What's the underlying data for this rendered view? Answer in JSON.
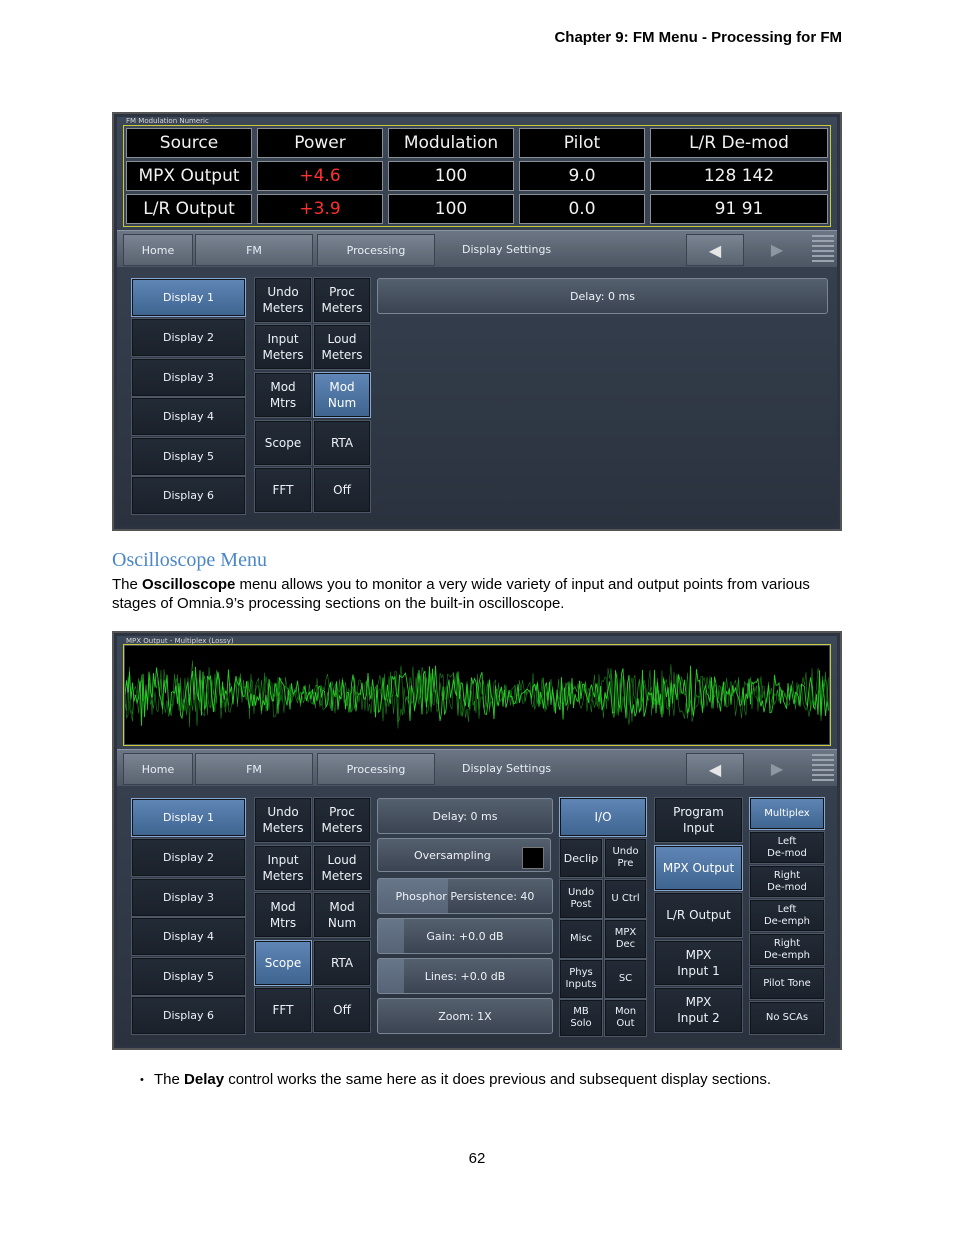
{
  "header": "Chapter 9:  FM Menu - Processing for FM",
  "section_title": "Oscilloscope Menu",
  "intro": {
    "before": "The ",
    "bold": "Oscilloscope",
    "after": " menu allows you to monitor a very wide variety of input and output points from various stages of Omnia.9’s processing sections on the built-in oscilloscope."
  },
  "bullet": {
    "before": "The ",
    "bold": "Delay",
    "after": " control works the same here as it does previous and subsequent display sections."
  },
  "page_number": "62",
  "nav": {
    "home": "Home",
    "fm": "FM",
    "processing": "Processing",
    "display_settings": "Display Settings",
    "prev_icon": "triangle-left-icon",
    "next_icon": "triangle-right-icon",
    "menu_icon": "gripper-lines-icon"
  },
  "displays": [
    "Display 1",
    "Display 2",
    "Display 3",
    "Display 4",
    "Display 5",
    "Display 6"
  ],
  "meter_buttons": {
    "undo_meters": "Undo\nMeters",
    "proc_meters": "Proc\nMeters",
    "input_meters": "Input\nMeters",
    "loud_meters": "Loud\nMeters",
    "mod_mtrs": "Mod\nMtrs",
    "mod_num": "Mod\nNum",
    "scope": "Scope",
    "rta": "RTA",
    "fft": "FFT",
    "off": "Off"
  },
  "shot1": {
    "title": "FM Modulation Numeric",
    "headers": [
      "Source",
      "Power",
      "Modulation",
      "Pilot",
      "L/R De-mod"
    ],
    "rows": [
      [
        "MPX Output",
        "+4.6",
        "100",
        "9.0",
        "128 142"
      ],
      [
        "L/R Output",
        "+3.9",
        "100",
        "0.0",
        "91 91"
      ]
    ],
    "delay": "Delay: 0 ms",
    "active_display": "Display 1",
    "active_mode": "Mod Num",
    "accent_colors": {
      "warning": "#ff3030",
      "active": "#4f78a8"
    }
  },
  "shot2": {
    "title": "MPX Output - Multiplex (Lossy)",
    "trace_color": "#2bd52b",
    "active_display": "Display 1",
    "active_mode": "Scope",
    "controls": {
      "delay": "Delay: 0 ms",
      "oversampling": "Oversampling",
      "phosphor": "Phosphor Persistence: 40",
      "phosphor_level": 0.4,
      "gain": "Gain: +0.0 dB",
      "gain_level": 0.15,
      "lines": "Lines: +0.0 dB",
      "lines_level": 0.15,
      "zoom": "Zoom: 1X"
    },
    "io": {
      "io": "I/O",
      "declip": "Declip",
      "undo_pre": "Undo\nPre",
      "undo_post": "Undo\nPost",
      "u_ctrl": "U Ctrl",
      "misc": "Misc",
      "mpx_dec": "MPX\nDec",
      "phys_inputs": "Phys\nInputs",
      "sc": "SC",
      "mb_solo": "MB\nSolo",
      "mon_out": "Mon\nOut"
    },
    "sources": {
      "program_input": "Program\nInput",
      "mpx_output": "MPX Output",
      "lr_output": "L/R Output",
      "mpx_input_1": "MPX\nInput 1",
      "mpx_input_2": "MPX\nInput 2"
    },
    "signals": {
      "multiplex": "Multiplex",
      "left_demod": "Left\nDe-mod",
      "right_demod": "Right\nDe-mod",
      "left_deemph": "Left\nDe-emph",
      "right_deemph": "Right\nDe-emph",
      "pilot_tone": "Pilot Tone",
      "no_scas": "No SCAs"
    }
  }
}
